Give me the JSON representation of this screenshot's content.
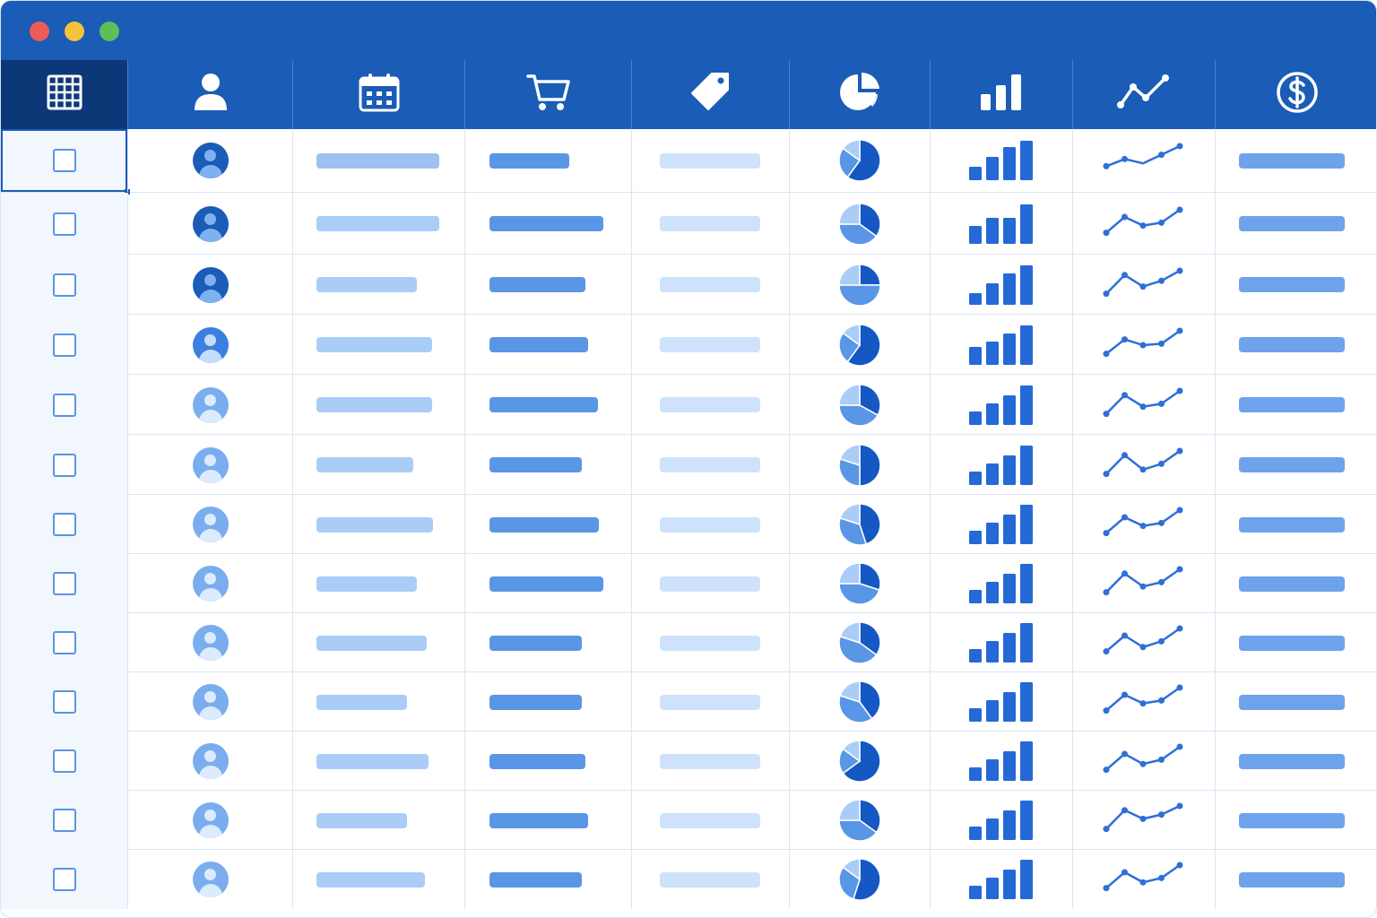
{
  "window": {
    "controls": [
      {
        "name": "close-dot",
        "color": "#ec5d57"
      },
      {
        "name": "minimize-dot",
        "color": "#f5c33b"
      },
      {
        "name": "zoom-dot",
        "color": "#5fbe5c"
      }
    ]
  },
  "header": {
    "columns": [
      {
        "icon": "grid-icon"
      },
      {
        "icon": "user-icon"
      },
      {
        "icon": "calendar-icon"
      },
      {
        "icon": "shopping-cart-icon"
      },
      {
        "icon": "price-tag-icon"
      },
      {
        "icon": "pie-chart-icon"
      },
      {
        "icon": "bar-chart-icon"
      },
      {
        "icon": "line-chart-icon"
      },
      {
        "icon": "dollar-circle-icon"
      }
    ]
  },
  "colors": {
    "header_bg": "#1a5cb6",
    "header_active": "#0d3878",
    "date_bar": "#a9cdf7",
    "date_bar_first": "#9dc1f0",
    "cart_bar": "#5a96e6",
    "tag_bar": "#cfe2fb",
    "amount_bar": "#6ea3ec",
    "bar_chart": "#2569d6",
    "line_chart": "#2e6fd8",
    "pie_dark": "#1558c4",
    "pie_mid": "#5a96e6",
    "pie_light": "#a9cdf7"
  },
  "rows": [
    {
      "checked": false,
      "avatar": "dark",
      "date_fill": 1.0,
      "cart_fill": 0.7,
      "pie": [
        0.6,
        0.25,
        0.15
      ],
      "bars": [
        0.35,
        0.6,
        0.85,
        1.0
      ],
      "trend": [
        0.3,
        0.55,
        0.4,
        0.7,
        1.0
      ]
    },
    {
      "checked": false,
      "avatar": "dark",
      "date_fill": 1.0,
      "cart_fill": 1.0,
      "pie": [
        0.35,
        0.4,
        0.25
      ],
      "bars": [
        0.45,
        0.65,
        0.65,
        1.0
      ],
      "trend": [
        0.2,
        0.75,
        0.45,
        0.55,
        1.0
      ]
    },
    {
      "checked": false,
      "avatar": "dark",
      "date_fill": 0.82,
      "cart_fill": 0.84,
      "pie": [
        0.25,
        0.5,
        0.25
      ],
      "bars": [
        0.3,
        0.55,
        0.8,
        1.0
      ],
      "trend": [
        0.2,
        0.85,
        0.45,
        0.65,
        1.0
      ]
    },
    {
      "checked": false,
      "avatar": "mid",
      "date_fill": 0.94,
      "cart_fill": 0.87,
      "pie": [
        0.6,
        0.25,
        0.15
      ],
      "bars": [
        0.45,
        0.6,
        0.8,
        1.0
      ],
      "trend": [
        0.2,
        0.7,
        0.5,
        0.55,
        1.0
      ]
    },
    {
      "checked": false,
      "avatar": "light",
      "date_fill": 0.94,
      "cart_fill": 0.95,
      "pie": [
        0.33,
        0.42,
        0.25
      ],
      "bars": [
        0.35,
        0.55,
        0.75,
        1.0
      ],
      "trend": [
        0.2,
        0.85,
        0.45,
        0.55,
        1.0
      ]
    },
    {
      "checked": false,
      "avatar": "light",
      "date_fill": 0.79,
      "cart_fill": 0.81,
      "pie": [
        0.5,
        0.3,
        0.2
      ],
      "bars": [
        0.35,
        0.55,
        0.75,
        1.0
      ],
      "trend": [
        0.2,
        0.85,
        0.35,
        0.55,
        1.0
      ]
    },
    {
      "checked": false,
      "avatar": "light",
      "date_fill": 0.95,
      "cart_fill": 0.96,
      "pie": [
        0.45,
        0.35,
        0.2
      ],
      "bars": [
        0.35,
        0.55,
        0.75,
        1.0
      ],
      "trend": [
        0.2,
        0.75,
        0.45,
        0.55,
        1.0
      ]
    },
    {
      "checked": false,
      "avatar": "light",
      "date_fill": 0.82,
      "cart_fill": 1.0,
      "pie": [
        0.3,
        0.45,
        0.25
      ],
      "bars": [
        0.35,
        0.55,
        0.75,
        1.0
      ],
      "trend": [
        0.2,
        0.85,
        0.4,
        0.55,
        1.0
      ]
    },
    {
      "checked": false,
      "avatar": "light",
      "date_fill": 0.9,
      "cart_fill": 0.81,
      "pie": [
        0.35,
        0.45,
        0.2
      ],
      "bars": [
        0.35,
        0.55,
        0.75,
        1.0
      ],
      "trend": [
        0.2,
        0.75,
        0.35,
        0.55,
        1.0
      ]
    },
    {
      "checked": false,
      "avatar": "light",
      "date_fill": 0.74,
      "cart_fill": 0.81,
      "pie": [
        0.4,
        0.4,
        0.2
      ],
      "bars": [
        0.35,
        0.55,
        0.75,
        1.0
      ],
      "trend": [
        0.2,
        0.75,
        0.45,
        0.55,
        1.0
      ]
    },
    {
      "checked": false,
      "avatar": "light",
      "date_fill": 0.91,
      "cart_fill": 0.84,
      "pie": [
        0.65,
        0.2,
        0.15
      ],
      "bars": [
        0.35,
        0.55,
        0.75,
        1.0
      ],
      "trend": [
        0.2,
        0.75,
        0.4,
        0.55,
        1.0
      ]
    },
    {
      "checked": false,
      "avatar": "light",
      "date_fill": 0.74,
      "cart_fill": 0.87,
      "pie": [
        0.35,
        0.4,
        0.25
      ],
      "bars": [
        0.35,
        0.55,
        0.75,
        1.0
      ],
      "trend": [
        0.2,
        0.85,
        0.55,
        0.7,
        1.0
      ]
    },
    {
      "checked": false,
      "avatar": "light",
      "date_fill": 0.88,
      "cart_fill": 0.81,
      "pie": [
        0.55,
        0.3,
        0.15
      ],
      "bars": [
        0.35,
        0.55,
        0.75,
        1.0
      ],
      "trend": [
        0.2,
        0.75,
        0.4,
        0.55,
        1.0
      ]
    }
  ]
}
